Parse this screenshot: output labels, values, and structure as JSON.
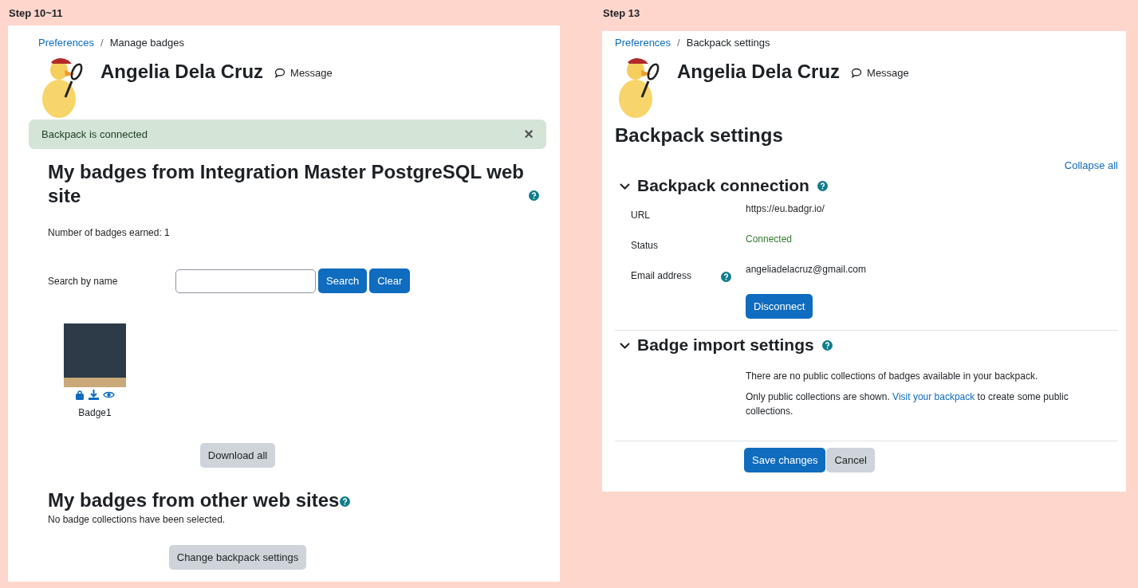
{
  "panels": [
    {
      "step": "Step 10~11",
      "breadcrumb": {
        "parent": "Preferences",
        "separator": "/",
        "current": "Manage badges"
      },
      "user": {
        "name": "Angelia Dela Cruz",
        "message": "Message"
      },
      "alert": {
        "text": "Backpack is connected",
        "close": "×"
      },
      "heading": "My badges from Integration Master PostgreSQL web site",
      "earned": "Number of badges earned: 1",
      "search": {
        "label": "Search by name",
        "buttons": [
          "Search",
          "Clear"
        ]
      },
      "badges": [
        {
          "name": "Badge1"
        }
      ],
      "download": "Download all",
      "other_heading": "My badges from other web sites",
      "other_text": "No badge collections have been selected.",
      "settings_button": "Change backpack settings"
    },
    {
      "step": "Step 13",
      "breadcrumb": {
        "parent": "Preferences",
        "separator": "/",
        "current": "Backpack settings"
      },
      "user": {
        "name": "Angelia Dela Cruz",
        "message": "Message"
      },
      "page_title": "Backpack settings",
      "collapse": "Collapse all",
      "sections": [
        {
          "title": "Backpack connection",
          "fields": [
            {
              "label": "URL",
              "value": "https://eu.badgr.io/",
              "kind": "text",
              "help": false
            },
            {
              "label": "Status",
              "value": "Connected",
              "kind": "status",
              "help": false
            },
            {
              "label": "Email address",
              "value": "angeliadelacruz@gmail.com",
              "kind": "text",
              "help": true
            }
          ],
          "button": "Disconnect"
        },
        {
          "title": "Badge import settings",
          "paragraphs": [
            {
              "before": "There are no public collections of badges available in your backpack."
            },
            {
              "before": "Only public collections are shown. ",
              "link": "Visit your backpack",
              "after": " to create some public collections."
            }
          ]
        }
      ],
      "buttons": [
        {
          "label": "Save changes",
          "primary": true
        },
        {
          "label": "Cancel",
          "primary": false
        }
      ]
    }
  ]
}
